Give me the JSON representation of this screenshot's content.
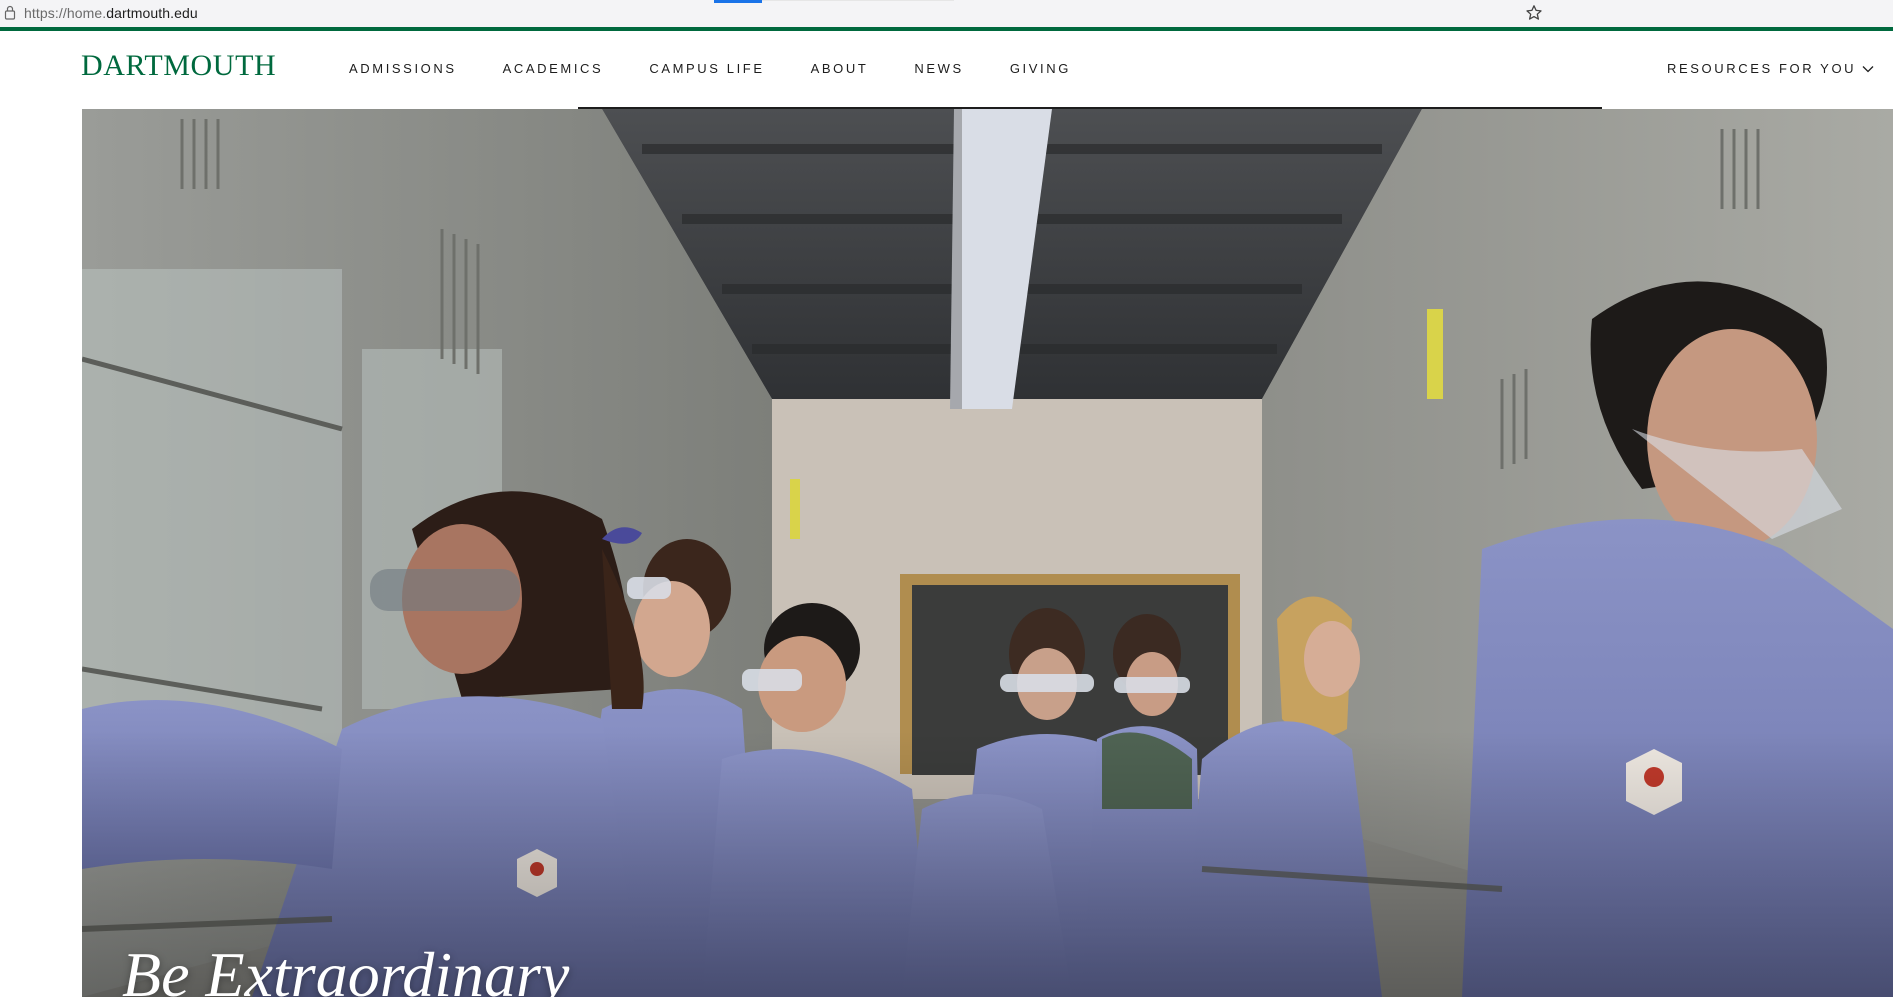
{
  "browser": {
    "url_scheme_prefix": "https://home.",
    "url_host": "dartmouth.edu",
    "icons": {
      "lock": "lock-icon",
      "bookmark": "star-icon"
    }
  },
  "site": {
    "wordmark": "DARTMOUTH",
    "brand_color": "#00693e",
    "nav": [
      {
        "label": "ADMISSIONS"
      },
      {
        "label": "ACADEMICS"
      },
      {
        "label": "CAMPUS LIFE"
      },
      {
        "label": "ABOUT"
      },
      {
        "label": "NEWS"
      },
      {
        "label": "GIVING"
      }
    ],
    "resources_label": "RESOURCES FOR YOU",
    "resources_icon": "chevron-down-icon"
  },
  "hero": {
    "title": "Be Extraordinary",
    "image_subject": "students in blue lab coats and goggles working at fume hoods in a chemistry lab"
  }
}
